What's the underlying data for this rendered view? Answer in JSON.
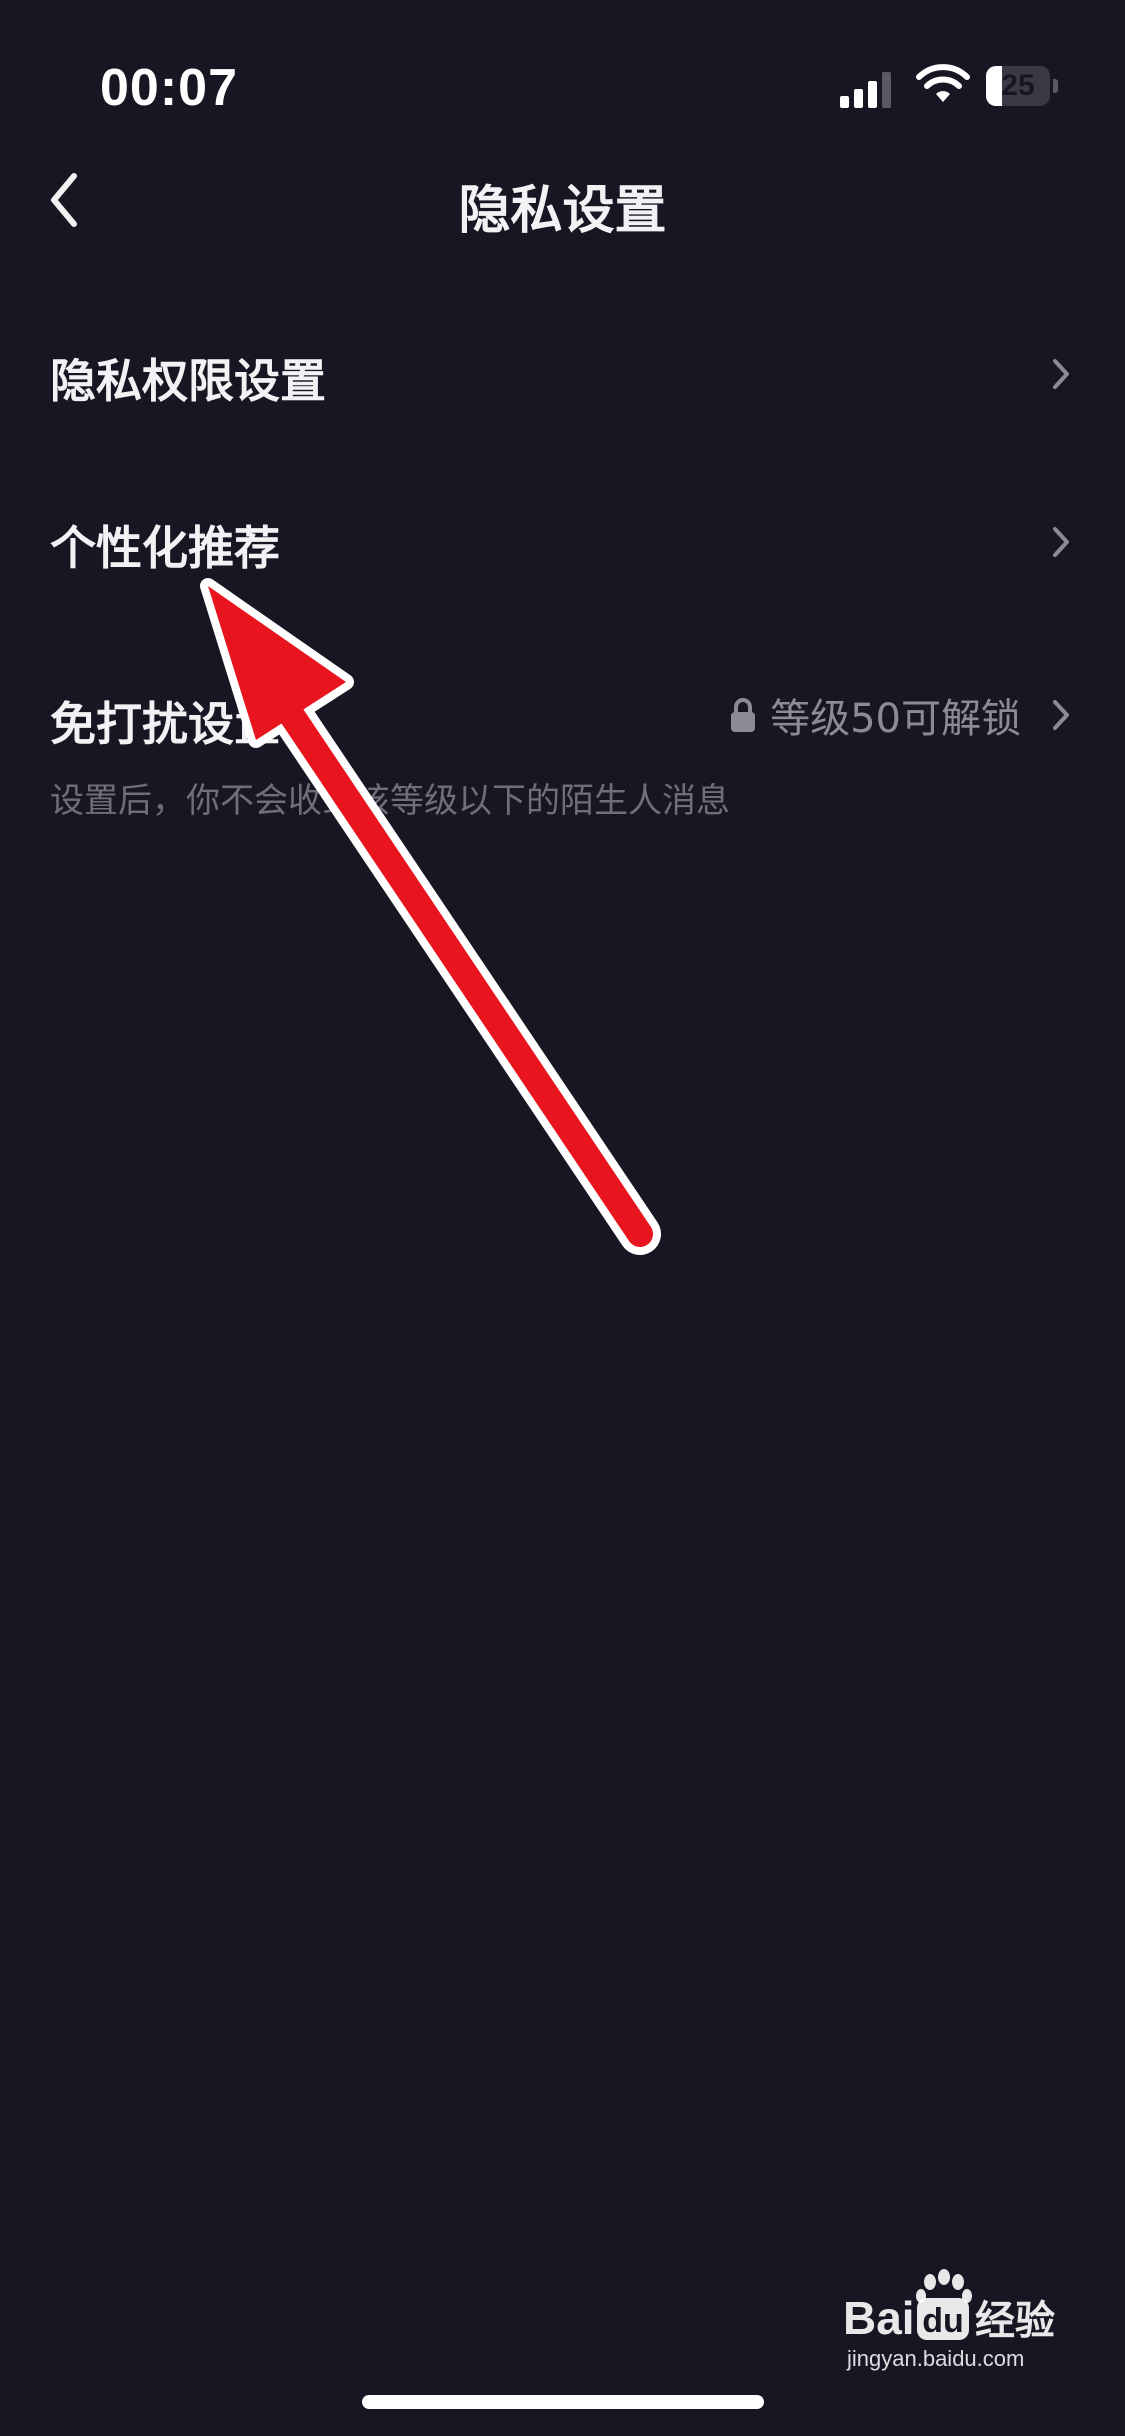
{
  "status_bar": {
    "time": "00:07",
    "battery_level": "25",
    "battery_fraction": 0.25
  },
  "nav": {
    "title": "隐私设置",
    "back_icon": "chevron-left-icon"
  },
  "settings": {
    "privacy_permissions": {
      "label": "隐私权限设置"
    },
    "personalized_recommend": {
      "label": "个性化推荐"
    },
    "do_not_disturb": {
      "label": "免打扰设置",
      "value": "等级50可解锁",
      "value_icon": "lock-icon",
      "description": "设置后，你不会收到该等级以下的陌生人消息"
    }
  },
  "annotation": {
    "arrow_color": "#e8141e",
    "outline_color": "#ffffff"
  },
  "watermark": {
    "brand": "Bai",
    "brand_suffix": "经验",
    "domain": "jingyan.baidu.com"
  },
  "colors": {
    "background": "#171724",
    "text_primary": "#f2f2f5",
    "text_secondary": "#8b8b96",
    "text_tertiary": "#6f6f7a"
  }
}
